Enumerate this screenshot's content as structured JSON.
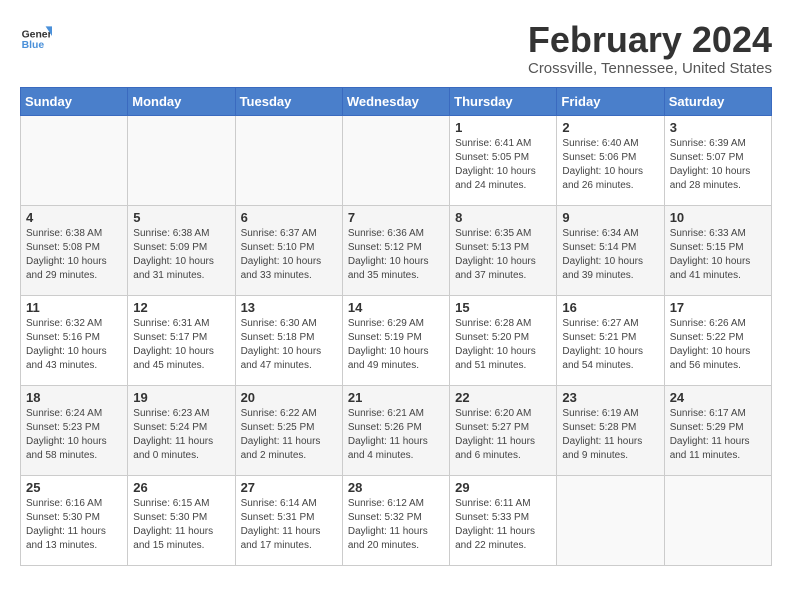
{
  "header": {
    "logo_line1": "General",
    "logo_line2": "Blue",
    "month_year": "February 2024",
    "location": "Crossville, Tennessee, United States"
  },
  "weekdays": [
    "Sunday",
    "Monday",
    "Tuesday",
    "Wednesday",
    "Thursday",
    "Friday",
    "Saturday"
  ],
  "weeks": [
    [
      {
        "day": "",
        "info": ""
      },
      {
        "day": "",
        "info": ""
      },
      {
        "day": "",
        "info": ""
      },
      {
        "day": "",
        "info": ""
      },
      {
        "day": "1",
        "info": "Sunrise: 6:41 AM\nSunset: 5:05 PM\nDaylight: 10 hours\nand 24 minutes."
      },
      {
        "day": "2",
        "info": "Sunrise: 6:40 AM\nSunset: 5:06 PM\nDaylight: 10 hours\nand 26 minutes."
      },
      {
        "day": "3",
        "info": "Sunrise: 6:39 AM\nSunset: 5:07 PM\nDaylight: 10 hours\nand 28 minutes."
      }
    ],
    [
      {
        "day": "4",
        "info": "Sunrise: 6:38 AM\nSunset: 5:08 PM\nDaylight: 10 hours\nand 29 minutes."
      },
      {
        "day": "5",
        "info": "Sunrise: 6:38 AM\nSunset: 5:09 PM\nDaylight: 10 hours\nand 31 minutes."
      },
      {
        "day": "6",
        "info": "Sunrise: 6:37 AM\nSunset: 5:10 PM\nDaylight: 10 hours\nand 33 minutes."
      },
      {
        "day": "7",
        "info": "Sunrise: 6:36 AM\nSunset: 5:12 PM\nDaylight: 10 hours\nand 35 minutes."
      },
      {
        "day": "8",
        "info": "Sunrise: 6:35 AM\nSunset: 5:13 PM\nDaylight: 10 hours\nand 37 minutes."
      },
      {
        "day": "9",
        "info": "Sunrise: 6:34 AM\nSunset: 5:14 PM\nDaylight: 10 hours\nand 39 minutes."
      },
      {
        "day": "10",
        "info": "Sunrise: 6:33 AM\nSunset: 5:15 PM\nDaylight: 10 hours\nand 41 minutes."
      }
    ],
    [
      {
        "day": "11",
        "info": "Sunrise: 6:32 AM\nSunset: 5:16 PM\nDaylight: 10 hours\nand 43 minutes."
      },
      {
        "day": "12",
        "info": "Sunrise: 6:31 AM\nSunset: 5:17 PM\nDaylight: 10 hours\nand 45 minutes."
      },
      {
        "day": "13",
        "info": "Sunrise: 6:30 AM\nSunset: 5:18 PM\nDaylight: 10 hours\nand 47 minutes."
      },
      {
        "day": "14",
        "info": "Sunrise: 6:29 AM\nSunset: 5:19 PM\nDaylight: 10 hours\nand 49 minutes."
      },
      {
        "day": "15",
        "info": "Sunrise: 6:28 AM\nSunset: 5:20 PM\nDaylight: 10 hours\nand 51 minutes."
      },
      {
        "day": "16",
        "info": "Sunrise: 6:27 AM\nSunset: 5:21 PM\nDaylight: 10 hours\nand 54 minutes."
      },
      {
        "day": "17",
        "info": "Sunrise: 6:26 AM\nSunset: 5:22 PM\nDaylight: 10 hours\nand 56 minutes."
      }
    ],
    [
      {
        "day": "18",
        "info": "Sunrise: 6:24 AM\nSunset: 5:23 PM\nDaylight: 10 hours\nand 58 minutes."
      },
      {
        "day": "19",
        "info": "Sunrise: 6:23 AM\nSunset: 5:24 PM\nDaylight: 11 hours\nand 0 minutes."
      },
      {
        "day": "20",
        "info": "Sunrise: 6:22 AM\nSunset: 5:25 PM\nDaylight: 11 hours\nand 2 minutes."
      },
      {
        "day": "21",
        "info": "Sunrise: 6:21 AM\nSunset: 5:26 PM\nDaylight: 11 hours\nand 4 minutes."
      },
      {
        "day": "22",
        "info": "Sunrise: 6:20 AM\nSunset: 5:27 PM\nDaylight: 11 hours\nand 6 minutes."
      },
      {
        "day": "23",
        "info": "Sunrise: 6:19 AM\nSunset: 5:28 PM\nDaylight: 11 hours\nand 9 minutes."
      },
      {
        "day": "24",
        "info": "Sunrise: 6:17 AM\nSunset: 5:29 PM\nDaylight: 11 hours\nand 11 minutes."
      }
    ],
    [
      {
        "day": "25",
        "info": "Sunrise: 6:16 AM\nSunset: 5:30 PM\nDaylight: 11 hours\nand 13 minutes."
      },
      {
        "day": "26",
        "info": "Sunrise: 6:15 AM\nSunset: 5:30 PM\nDaylight: 11 hours\nand 15 minutes."
      },
      {
        "day": "27",
        "info": "Sunrise: 6:14 AM\nSunset: 5:31 PM\nDaylight: 11 hours\nand 17 minutes."
      },
      {
        "day": "28",
        "info": "Sunrise: 6:12 AM\nSunset: 5:32 PM\nDaylight: 11 hours\nand 20 minutes."
      },
      {
        "day": "29",
        "info": "Sunrise: 6:11 AM\nSunset: 5:33 PM\nDaylight: 11 hours\nand 22 minutes."
      },
      {
        "day": "",
        "info": ""
      },
      {
        "day": "",
        "info": ""
      }
    ]
  ]
}
